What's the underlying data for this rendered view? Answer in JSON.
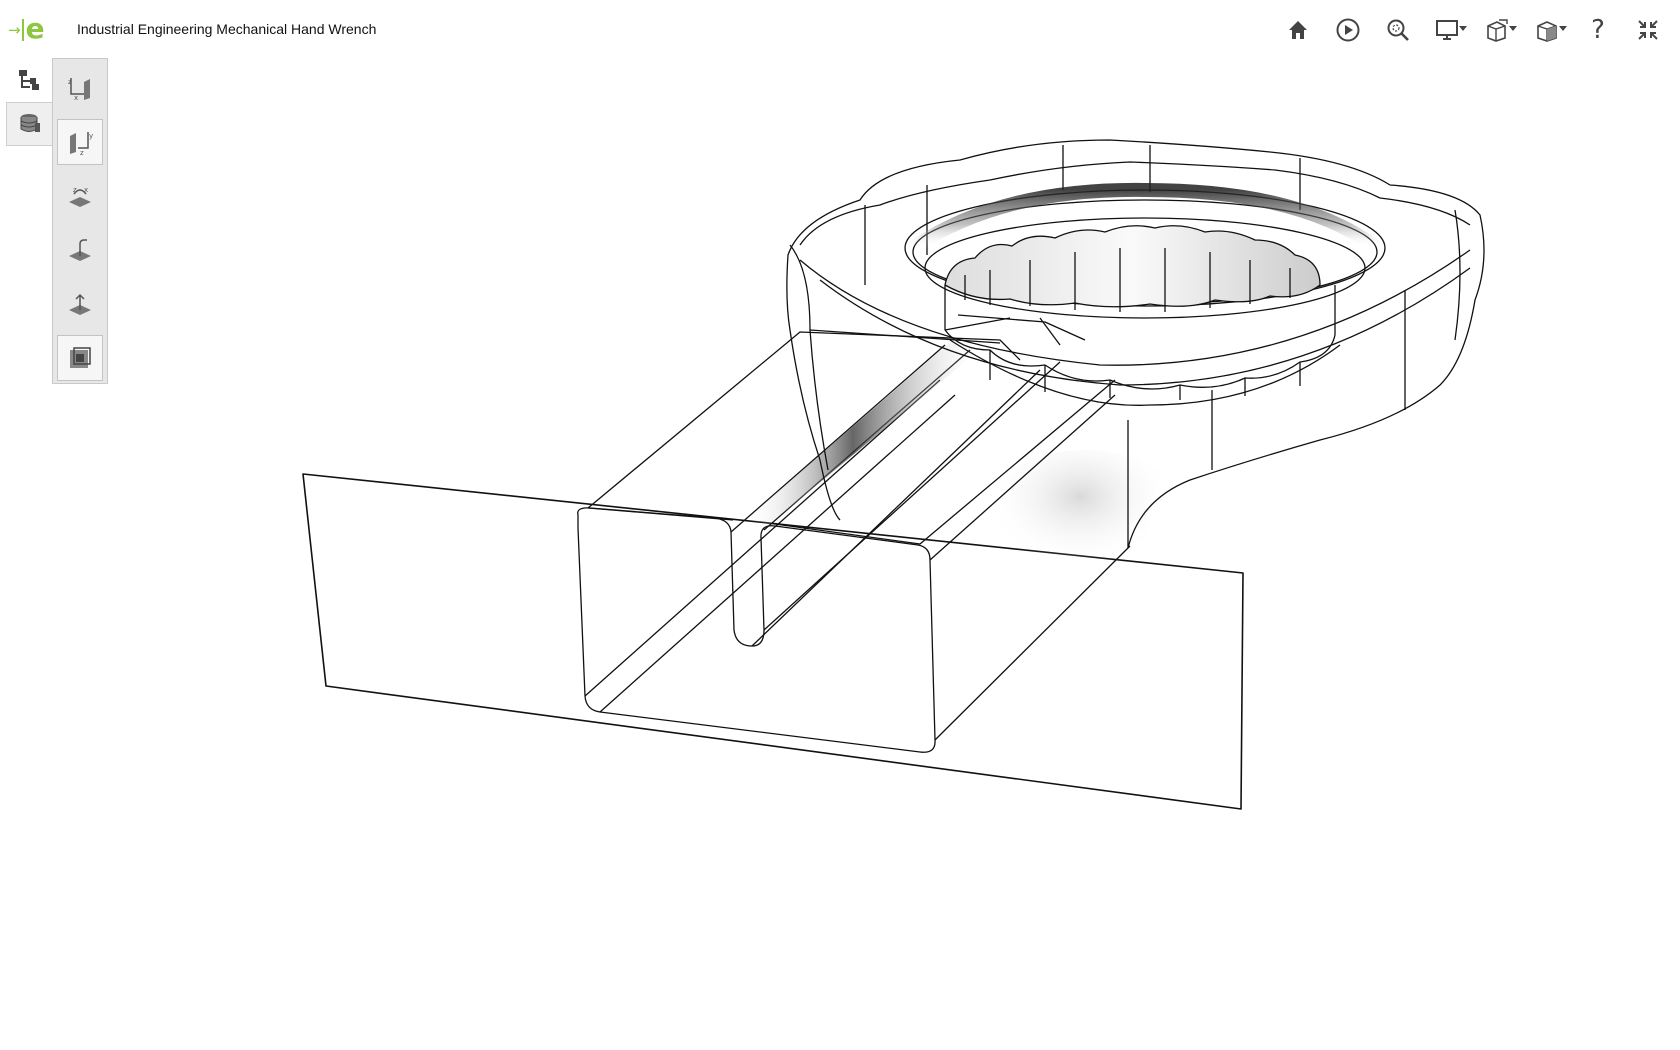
{
  "app": {
    "document_title": "Industrial Engineering Mechanical Hand Wrench"
  },
  "colors": {
    "brand_accent": "#8dc63f",
    "panel_background": "#e7e7e7",
    "icon_gray": "#444444",
    "model_line": "#111111"
  },
  "header": {
    "logo_icon": "brand-logo-icon",
    "toolbar_icons": [
      "home-icon",
      "play-icon",
      "zoom-icon",
      "display-mode-icon",
      "explode-icon",
      "section-icon",
      "help-icon",
      "fullscreen-exit-icon"
    ],
    "help_glyph": "?"
  },
  "left_palette": {
    "icons": [
      "model-tree-icon",
      "part-stack-icon"
    ],
    "active_index": 1
  },
  "view_panel": {
    "icons": [
      "front-view-icon",
      "side-view-icon",
      "top-view-icon",
      "bottom-view-icon",
      "iso-view-icon",
      "fit-view-icon"
    ],
    "selected_index": 1
  }
}
